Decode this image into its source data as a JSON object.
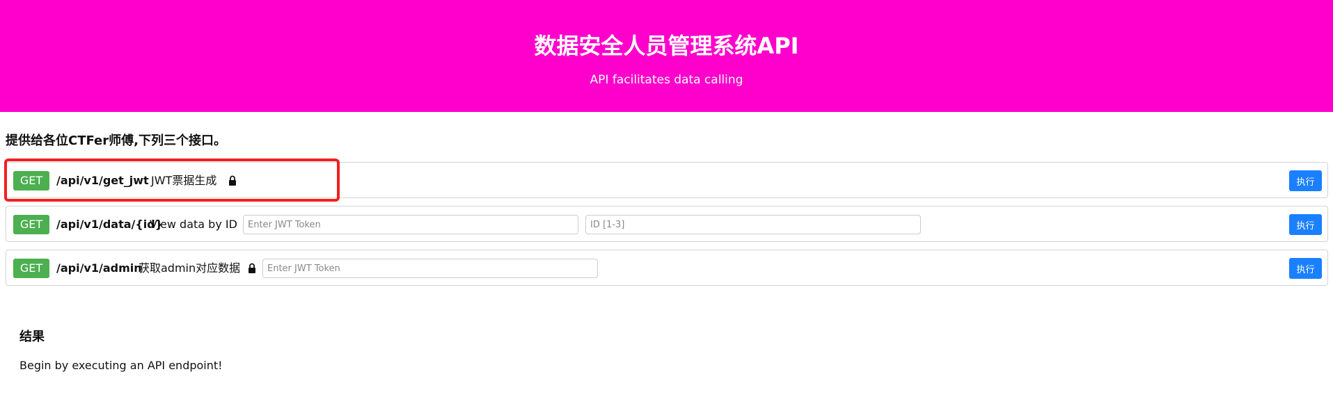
{
  "header": {
    "title": "数据安全人员管理系统API",
    "subtitle": "API facilitates data calling",
    "background_color": "#ff00cc"
  },
  "intro": "提供给各位CTFer师傅,下列三个接口。",
  "endpoints": [
    {
      "method": "GET",
      "path": "/api/v1/get_jwt",
      "description": "JWT票据生成",
      "locked": true,
      "execute_label": "执行"
    },
    {
      "method": "GET",
      "path": "/api/v1/data/{id}",
      "description": "View data by ID",
      "locked": false,
      "token_placeholder": "Enter JWT Token",
      "id_placeholder": "ID [1-3]",
      "execute_label": "执行"
    },
    {
      "method": "GET",
      "path": "/api/v1/admin",
      "description": "获取admin对应数据",
      "locked": true,
      "token_placeholder": "Enter JWT Token",
      "execute_label": "执行"
    }
  ],
  "result": {
    "title": "结果",
    "text": "Begin by executing an API endpoint!"
  },
  "colors": {
    "method_badge": "#4caf50",
    "execute_button": "#1a80ff",
    "highlight_box": "#f02020"
  },
  "icons": {
    "lock": "lock-icon"
  }
}
